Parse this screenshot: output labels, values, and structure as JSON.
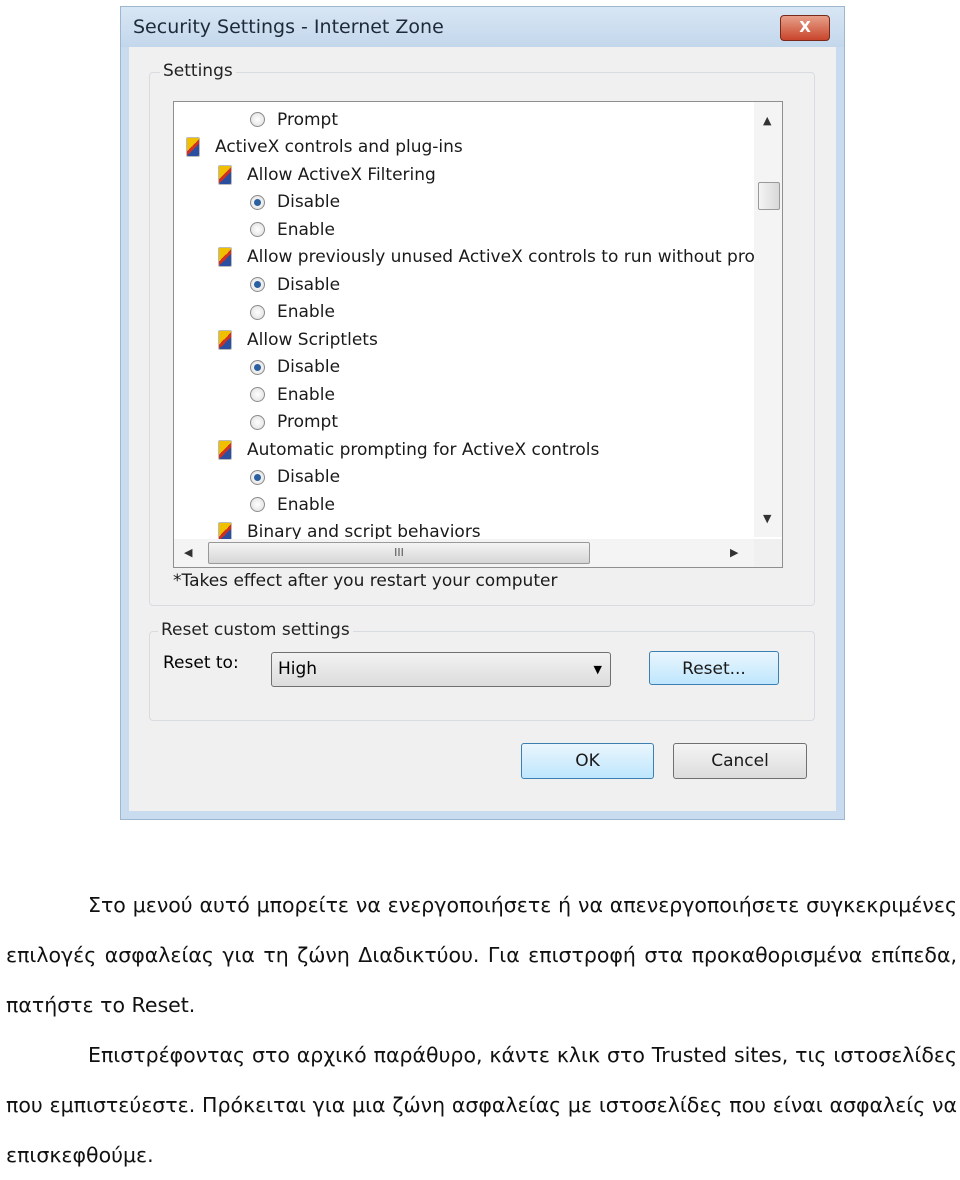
{
  "dialog": {
    "title": "Security Settings - Internet Zone",
    "close": "X",
    "settings_group": "Settings",
    "list": [
      {
        "type": "radio",
        "level": 2,
        "label": "Prompt",
        "checked": false
      },
      {
        "type": "category",
        "level": 1,
        "label": "ActiveX controls and plug-ins"
      },
      {
        "type": "setting",
        "level": 2,
        "label": "Allow ActiveX Filtering"
      },
      {
        "type": "radio",
        "level": 2,
        "label": "Disable",
        "checked": true
      },
      {
        "type": "radio",
        "level": 2,
        "label": "Enable",
        "checked": false
      },
      {
        "type": "setting",
        "level": 2,
        "label": "Allow previously unused ActiveX controls to run without prom"
      },
      {
        "type": "radio",
        "level": 2,
        "label": "Disable",
        "checked": true
      },
      {
        "type": "radio",
        "level": 2,
        "label": "Enable",
        "checked": false
      },
      {
        "type": "setting",
        "level": 2,
        "label": "Allow Scriptlets"
      },
      {
        "type": "radio",
        "level": 2,
        "label": "Disable",
        "checked": true
      },
      {
        "type": "radio",
        "level": 2,
        "label": "Enable",
        "checked": false
      },
      {
        "type": "radio",
        "level": 2,
        "label": "Prompt",
        "checked": false
      },
      {
        "type": "setting",
        "level": 2,
        "label": "Automatic prompting for ActiveX controls"
      },
      {
        "type": "radio",
        "level": 2,
        "label": "Disable",
        "checked": true
      },
      {
        "type": "radio",
        "level": 2,
        "label": "Enable",
        "checked": false
      },
      {
        "type": "setting",
        "level": 2,
        "label": "Binary and script behaviors"
      }
    ],
    "hscroll_grip": "III",
    "note": "*Takes effect after you restart your computer",
    "reset_group": "Reset custom settings",
    "reset_to_label": "Reset to:",
    "reset_to_value": "High",
    "reset_button": "Reset...",
    "ok": "OK",
    "cancel": "Cancel"
  },
  "text": {
    "p1": "Στο μενού αυτό μπορείτε να ενεργοποιήσετε ή να απενεργοποιήσετε συγκεκριμένες επιλογές ασφαλείας για τη ζώνη Διαδικτύου. Για επιστροφή στα προκαθορισμένα επίπεδα, πατήστε το Reset.",
    "p2": "Επιστρέφοντας στο αρχικό παράθυρο, κάντε κλικ στο Trusted sites, τις ιστοσελίδες που εμπιστεύεστε. Πρόκειται για μια ζώνη ασφαλείας με ιστοσελίδες που είναι ασφαλείς να επισκεφθούμε."
  }
}
